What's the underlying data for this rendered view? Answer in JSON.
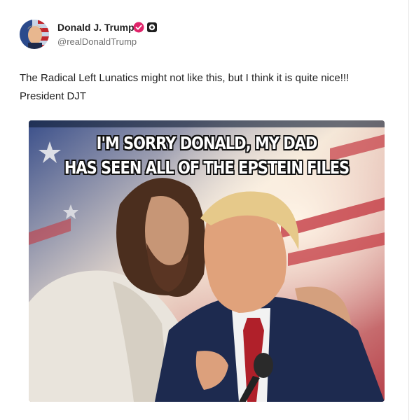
{
  "post": {
    "author_name": "Donald J. Trump",
    "author_handle": "@realDonaldTrump",
    "verified_icon": "verified-check-icon",
    "badge_icon": "plus-badge-icon",
    "body_text": "The Radical Left Lunatics might not like this, but I think it is quite nice!!!  President DJT",
    "image": {
      "caption_line1": "I'M SORRY DONALD, MY DAD",
      "caption_line2": "HAS SEEN ALL OF THE EPSTEIN FILES"
    }
  },
  "colors": {
    "verified": "#e0246a",
    "text": "#1f1f1f",
    "handle": "#6f6f6f"
  }
}
